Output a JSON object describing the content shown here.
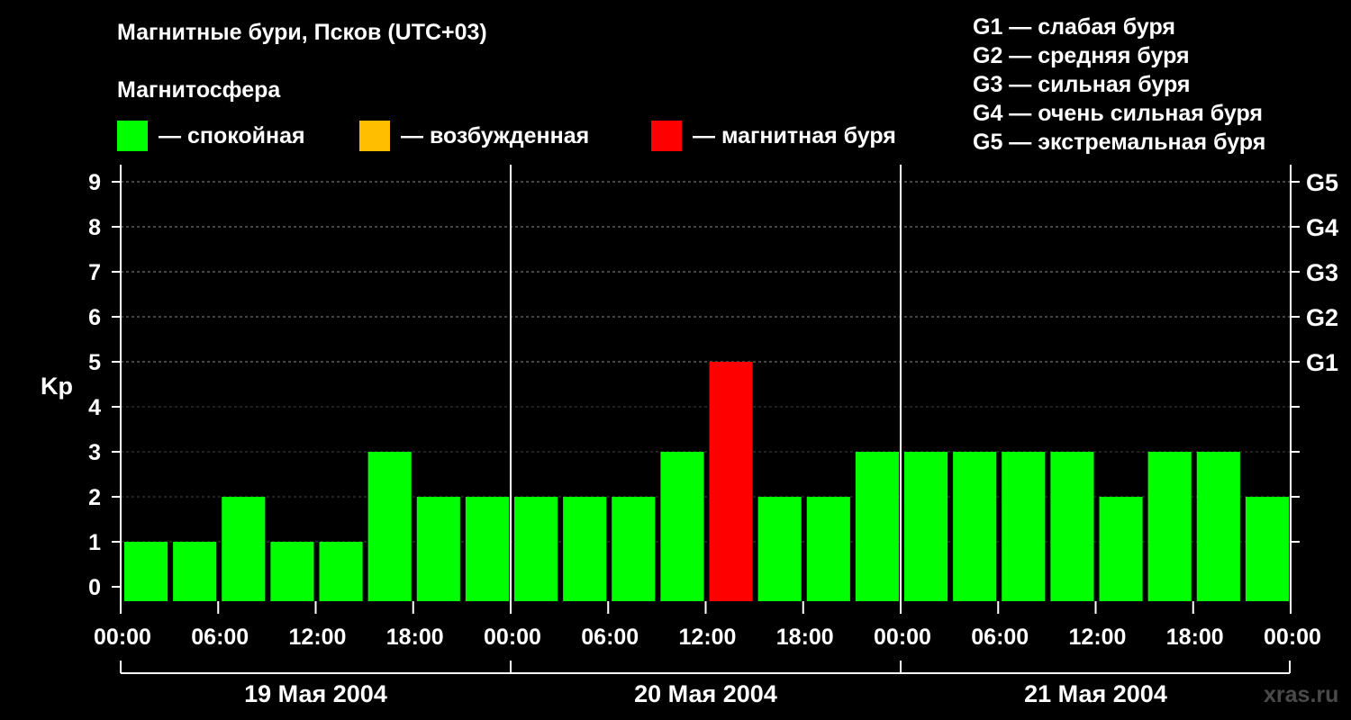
{
  "title": "Магнитные бури, Псков (UTC+03)",
  "subtitle": "Магнитосфера",
  "legend": [
    {
      "label": "— спокойная",
      "color": "#00ff00"
    },
    {
      "label": "— возбужденная",
      "color": "#ffbf00"
    },
    {
      "label": "— магнитная буря",
      "color": "#ff0000"
    }
  ],
  "storm_legend": [
    "G1 — слабая буря",
    "G2 — средняя буря",
    "G3 — сильная буря",
    "G4 — очень сильная буря",
    "G5 — экстремальная буря"
  ],
  "watermark": "xras.ru",
  "chart_data": {
    "type": "bar",
    "ylabel": "Kp",
    "ylim": [
      0,
      9
    ],
    "y_ticks": [
      "0",
      "1",
      "2",
      "3",
      "4",
      "5",
      "6",
      "7",
      "8",
      "9"
    ],
    "right_ticks": [
      {
        "value": 5,
        "label": "G1"
      },
      {
        "value": 6,
        "label": "G2"
      },
      {
        "value": 7,
        "label": "G3"
      },
      {
        "value": 8,
        "label": "G4"
      },
      {
        "value": 9,
        "label": "G5"
      }
    ],
    "x_tick_labels": [
      "00:00",
      "06:00",
      "12:00",
      "18:00",
      "00:00",
      "06:00",
      "12:00",
      "18:00",
      "00:00",
      "06:00",
      "12:00",
      "18:00",
      "00:00"
    ],
    "days": [
      "19 Мая 2004",
      "20 Мая 2004",
      "21 Мая 2004"
    ],
    "values": [
      1,
      1,
      2,
      1,
      1,
      3,
      2,
      2,
      2,
      2,
      2,
      3,
      5,
      2,
      2,
      3,
      3,
      3,
      3,
      3,
      2,
      3,
      3,
      2
    ],
    "bar_colors": [
      "#00ff00",
      "#00ff00",
      "#00ff00",
      "#00ff00",
      "#00ff00",
      "#00ff00",
      "#00ff00",
      "#00ff00",
      "#00ff00",
      "#00ff00",
      "#00ff00",
      "#00ff00",
      "#ff0000",
      "#00ff00",
      "#00ff00",
      "#00ff00",
      "#00ff00",
      "#00ff00",
      "#00ff00",
      "#00ff00",
      "#00ff00",
      "#00ff00",
      "#00ff00",
      "#00ff00"
    ],
    "grid": true
  }
}
